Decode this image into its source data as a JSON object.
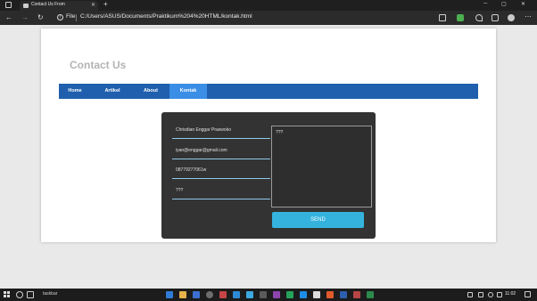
{
  "browser": {
    "tab_title": "Contact Us From",
    "tab_close": "✕",
    "new_tab": "+",
    "file_label": "File",
    "url": "C:/Users/ASUS/Documents/Praktikum%204%20HTML/kontak.html",
    "back": "←",
    "forward": "→",
    "reload": "↻",
    "menu": "⋯",
    "minimize": "─",
    "maximize": "▢",
    "close": "✕"
  },
  "page": {
    "title": "Contact Us",
    "nav": [
      {
        "label": "Home",
        "active": false
      },
      {
        "label": "Artikel",
        "active": false
      },
      {
        "label": "About",
        "active": false
      },
      {
        "label": "Kontak",
        "active": true
      }
    ],
    "form": {
      "name_value": "Chrisdian Enggar Praswoko",
      "email_value": "iyan@enggar@gmail.com",
      "phone_value": "08779277061w",
      "subject_value": "???",
      "message_value": "???",
      "send_label": "SEND"
    }
  },
  "taskbar": {
    "search_text": "taskbar",
    "time": "11:02"
  },
  "colors": {
    "navbar": "#1f5fae",
    "nav_active": "#3a8ee6",
    "send_button": "#34b3de",
    "form_bg": "#333333"
  }
}
